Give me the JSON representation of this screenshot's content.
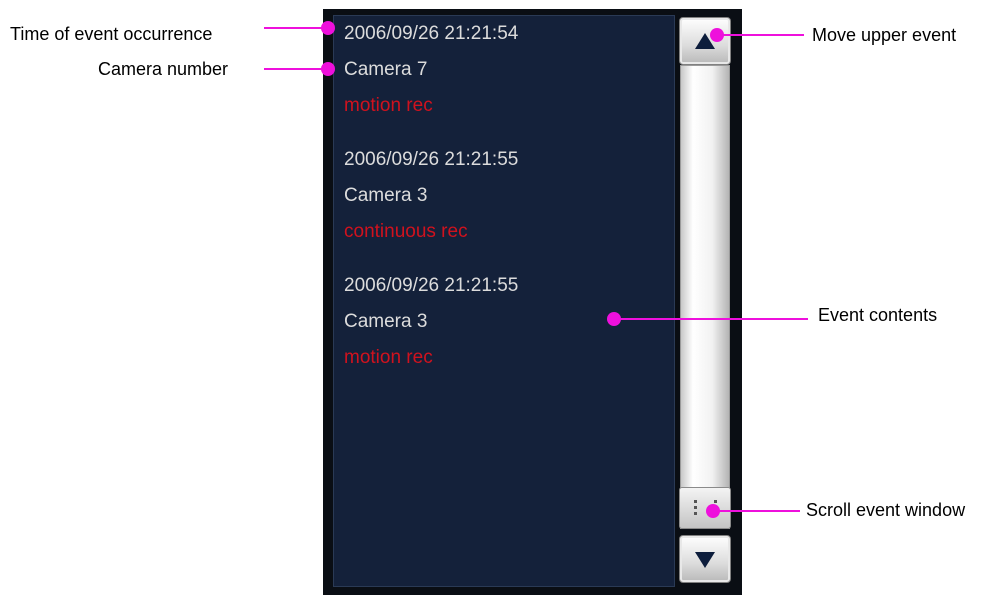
{
  "events": [
    {
      "time": "2006/09/26 21:21:54",
      "camera": "Camera 7",
      "status": "motion rec"
    },
    {
      "time": "2006/09/26 21:21:55",
      "camera": "Camera 3",
      "status": "continuous rec"
    },
    {
      "time": "2006/09/26 21:21:55",
      "camera": "Camera 3",
      "status": "motion rec"
    }
  ],
  "callouts": {
    "time_of_event": "Time of event occurrence",
    "camera_number": "Camera number",
    "move_upper_event": "Move upper event",
    "event_contents": "Event contents",
    "scroll_event_window": "Scroll event window"
  },
  "icons": {
    "scroll_up": "triangle-up-icon",
    "scroll_down": "triangle-down-icon",
    "scroll_thumb": "grip-icon"
  },
  "colors": {
    "list_background": "#14213a",
    "event_text": "#dcdcdc",
    "status_text": "#d0121e",
    "callout_line": "#ee10dc"
  }
}
